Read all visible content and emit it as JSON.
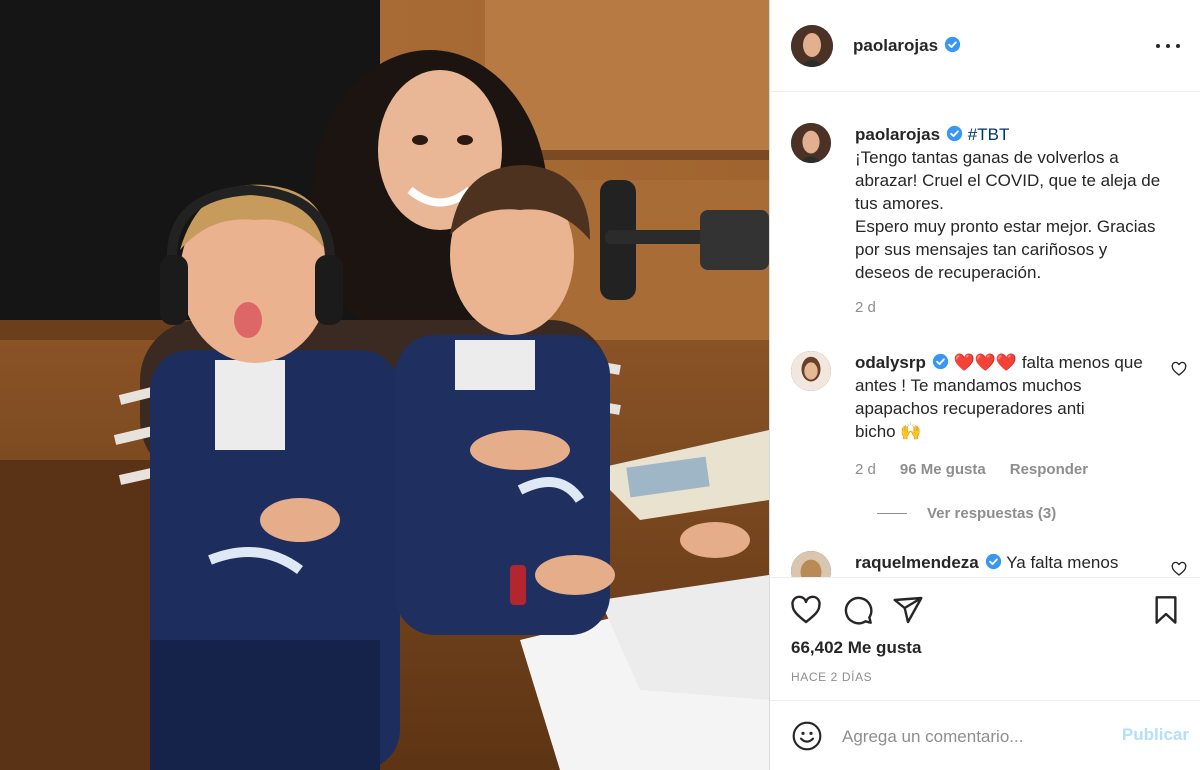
{
  "post": {
    "image_alt": "Woman hugging two boys in a radio studio",
    "author": {
      "username": "paolarojas",
      "verified": true
    },
    "caption": {
      "username": "paolarojas",
      "hashtag": "#TBT",
      "lines": [
        "¡Tengo tantas ganas de volverlos a",
        "abrazar! Cruel el COVID, que te aleja de",
        "tus amores.",
        "Espero muy pronto estar mejor. Gracias",
        "por sus mensajes tan cariñosos y",
        "deseos de recuperación."
      ],
      "time": "2 d"
    },
    "comments": [
      {
        "username": "odalysrp",
        "verified": true,
        "text_lines": [
          "❤️❤️❤️ falta menos que",
          "antes ! Te mandamos muchos",
          "apapachos recuperadores anti",
          "bicho 🙌"
        ],
        "time": "2 d",
        "likes": "96 Me gusta",
        "reply_label": "Responder",
        "view_replies": "Ver respuestas (3)"
      },
      {
        "username": "raquelmendeza",
        "verified": true,
        "text_lines": [
          "Ya falta menos"
        ]
      }
    ],
    "likes_count": "66,402 Me gusta",
    "date_label": "HACE 2 DÍAS",
    "add_comment": {
      "placeholder": "Agrega un comentario...",
      "publish_label": "Publicar"
    },
    "icons": {
      "more": "more-options-icon",
      "like": "heart-icon",
      "comment": "comment-icon",
      "share": "share-icon",
      "save": "bookmark-icon",
      "emoji": "emoji-icon",
      "verified": "verified-badge-icon"
    },
    "colors": {
      "verified_blue": "#3897f0",
      "link_blue": "#00376b",
      "publish_disabled": "#b2dffc",
      "muted_text": "#8e8e8e"
    }
  }
}
